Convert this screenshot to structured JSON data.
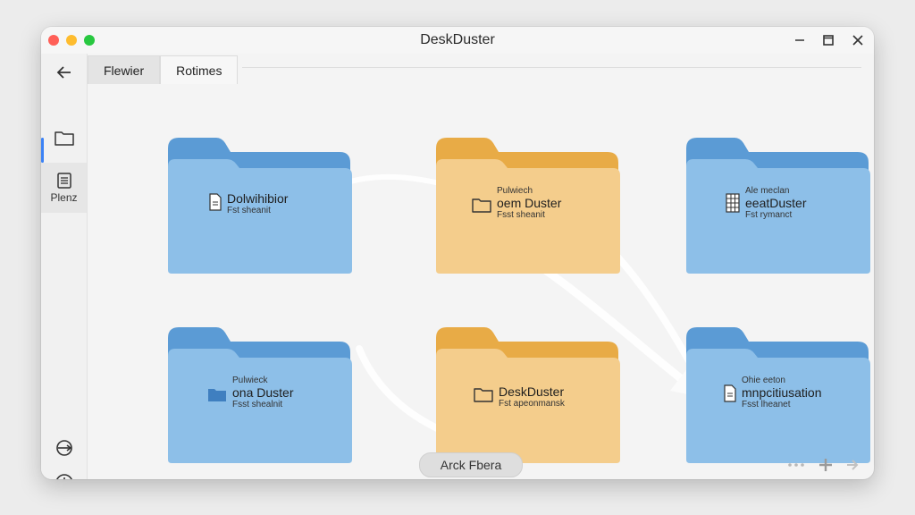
{
  "window": {
    "title": "DeskDuster"
  },
  "sidebar": {
    "files_label": "Plenz"
  },
  "tabs": [
    {
      "label": "Flewier"
    },
    {
      "label": "Rotimes"
    }
  ],
  "folders": [
    {
      "small_top": "",
      "main": "Dolwihibior",
      "small_bottom": "Fst sheanit",
      "color": "blue",
      "icon": "document-icon"
    },
    {
      "small_top": "Pulwiech",
      "main": "oem Duster",
      "small_bottom": "Fsst sheanit",
      "color": "yellow",
      "icon": "folder-outline-icon"
    },
    {
      "small_top": "Ale meclan",
      "main": "eeatDuster",
      "small_bottom": "Fst rymanct",
      "color": "blue",
      "icon": "spreadsheet-icon"
    },
    {
      "small_top": "Pulwieck",
      "main": "ona Duster",
      "small_bottom": "Fsst shealnit",
      "color": "blue",
      "icon": "folder-filled-icon"
    },
    {
      "small_top": "",
      "main": "DeskDuster",
      "small_bottom": "Fst apeonmansk",
      "color": "yellow",
      "icon": "folder-outline-icon"
    },
    {
      "small_top": "Ohie eeton",
      "main": "mnpcitiusation",
      "small_bottom": "Fsst lheanet",
      "color": "blue",
      "icon": "document-icon"
    }
  ],
  "bottom_bar": {
    "pill_label": "Arck Fbera"
  },
  "colors": {
    "blue_front": "#8dbfe8",
    "blue_back": "#5b9bd5",
    "yellow_front": "#f4cd8c",
    "yellow_back": "#e8ab46"
  }
}
